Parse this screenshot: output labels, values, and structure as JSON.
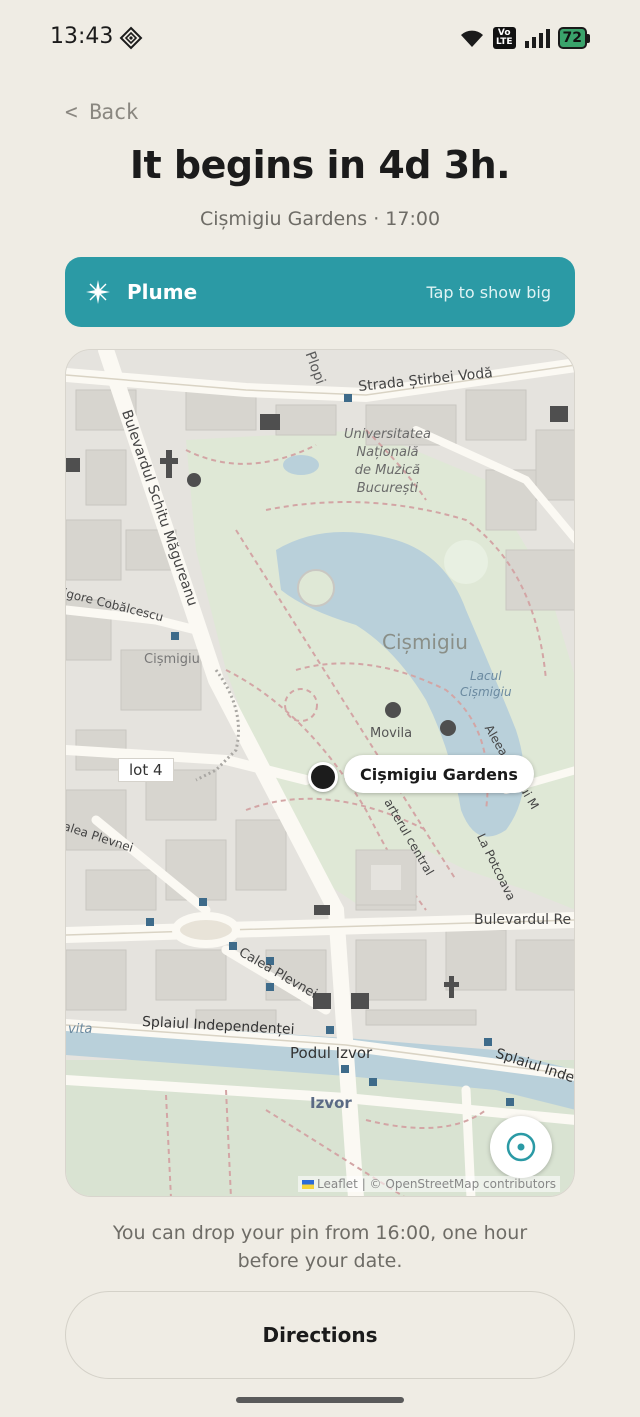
{
  "status_bar": {
    "time": "13:43",
    "volte": "Vo\nLTE",
    "battery": "72",
    "icons": [
      "app-notification-icon",
      "wifi-icon",
      "volte-icon",
      "signal-icon",
      "battery-charging-icon"
    ]
  },
  "nav": {
    "back_label": "< Back"
  },
  "header": {
    "title": "It begins in 4d 3h.",
    "subtitle": "Cișmigiu Gardens · 17:00"
  },
  "plume": {
    "label": "Plume",
    "hint": "Tap to show big",
    "background": "#2b9aa5",
    "icon": "sparkle-icon"
  },
  "map": {
    "labels": {
      "street_stirbei": "Strada Știrbei Vodă",
      "street_plopi": "Plopi",
      "street_schitu": "Bulevardul Schitu Măgureanu",
      "university": "Universitatea\nNațională\nde Muzică\nBucurești",
      "street_cobalcescu": "igore Cobălcescu",
      "cismigiu_small": "Cișmigiu",
      "cismigiu_large": "Cișmigiu",
      "lacul": "Lacul\nCișmigiu",
      "movila": "Movila",
      "aleea": "Aleea Podului M",
      "lot": "lot 4",
      "plevnei_upper": "alea Plevnei",
      "arterul": "arterul central",
      "potcoava": "La Potcoava",
      "bulevardul_re": "Bulevardul Re",
      "calea_plevnei": "Calea Plevnei",
      "splaiul_left": "Splaiul Independenței",
      "splaiul_right": "Splaiul Inde",
      "podul": "Podul Izvor",
      "izvor": "Izvor",
      "vita": "vita"
    },
    "pin_label": "Cișmigiu Gardens",
    "attribution": "Leaflet | © OpenStreetMap contributors"
  },
  "note": "You can drop your pin from 16:00, one hour before your date.",
  "directions_label": "Directions"
}
